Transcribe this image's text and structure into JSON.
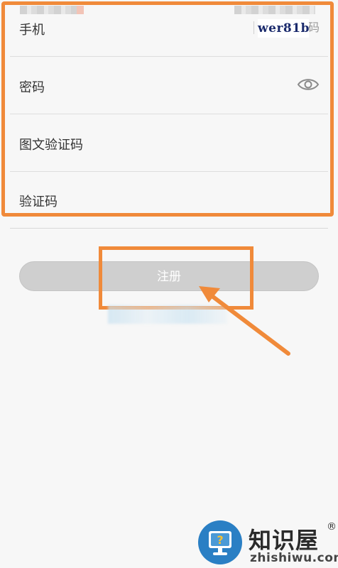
{
  "form": {
    "phone": {
      "label": "手机",
      "get_code": "获取验证码"
    },
    "password": {
      "label": "密码",
      "toggle_icon": "eye-icon"
    },
    "captcha": {
      "label": "图文验证码",
      "image_text": "wer81b"
    },
    "sms_code": {
      "label": "验证码"
    }
  },
  "actions": {
    "register_label": "注册"
  },
  "watermark": {
    "title": "知识屋",
    "reg_mark": "®",
    "domain": "zhishiwu.com",
    "logo_icon": "help-monitor-icon"
  },
  "colors": {
    "highlight": "#f08a3a",
    "button_disabled": "#cfcfcf",
    "background": "#f7f7f7",
    "logo_blue": "#2a7fc4"
  }
}
